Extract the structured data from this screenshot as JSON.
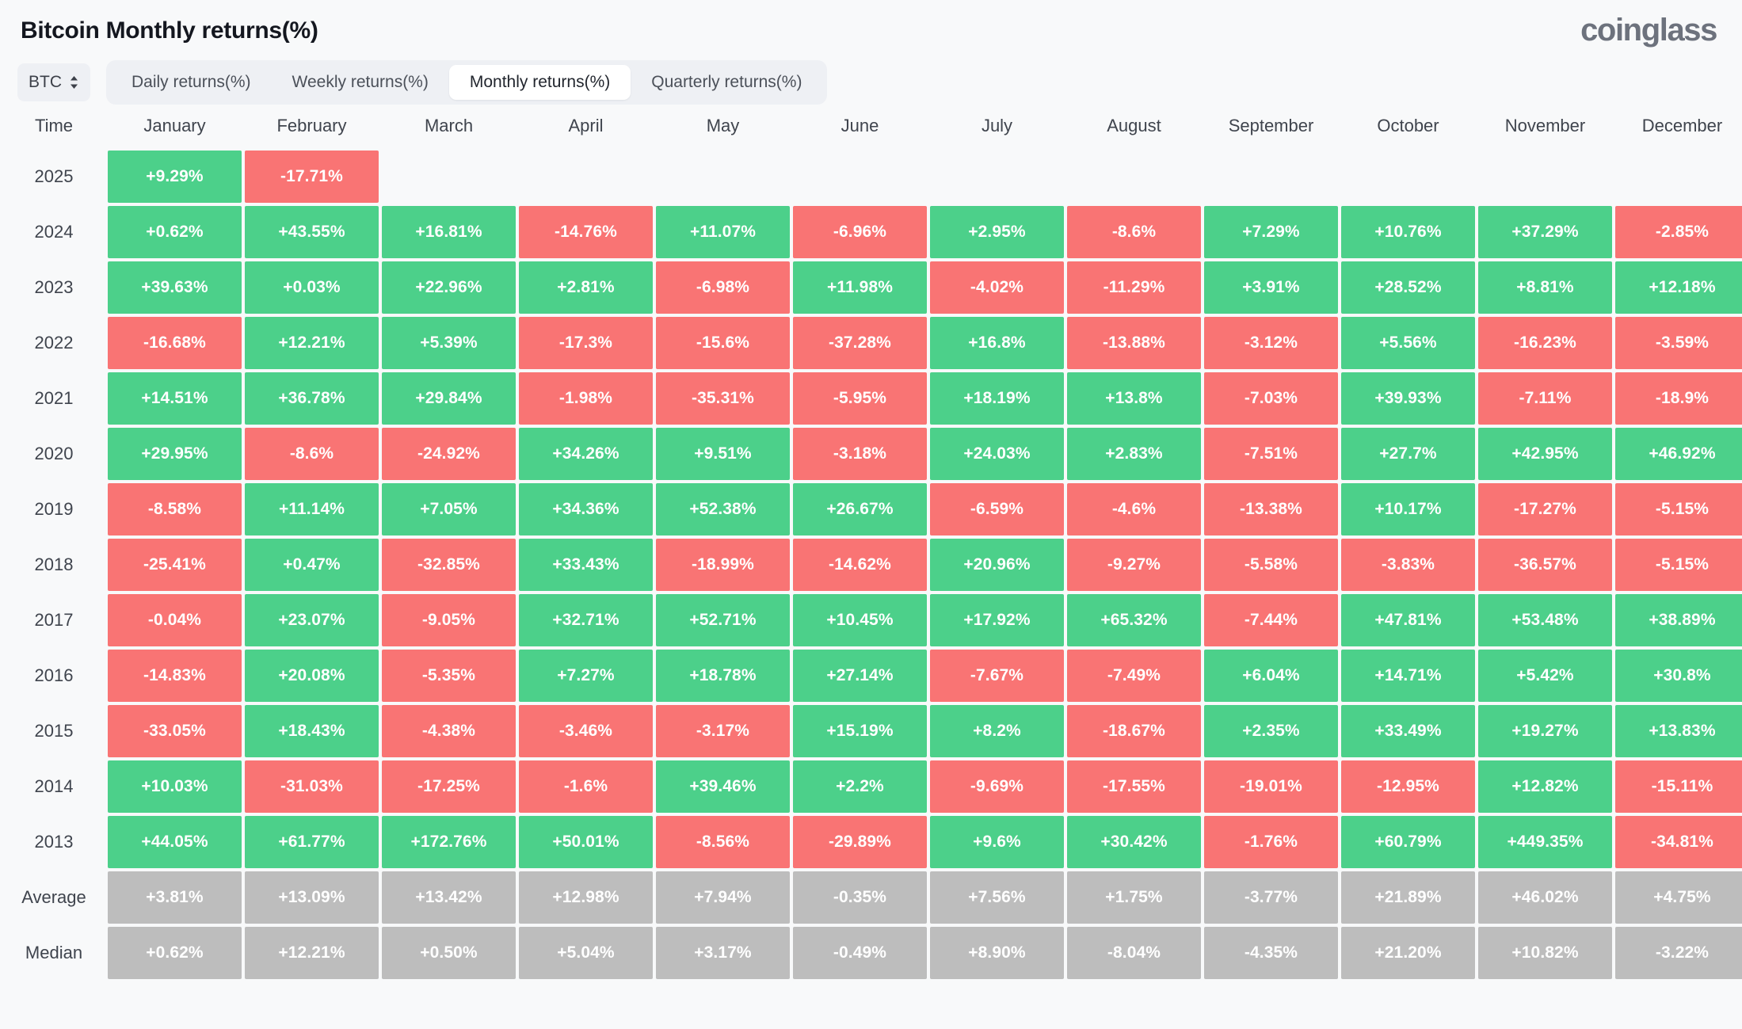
{
  "header": {
    "title": "Bitcoin Monthly returns(%)",
    "brand": "coinglass"
  },
  "controls": {
    "coin_selector": {
      "value": "BTC",
      "icon": "up-down-chevron-icon"
    },
    "tabs": [
      {
        "label": "Daily returns(%)",
        "active": false
      },
      {
        "label": "Weekly returns(%)",
        "active": false
      },
      {
        "label": "Monthly returns(%)",
        "active": true
      },
      {
        "label": "Quarterly returns(%)",
        "active": false
      }
    ]
  },
  "colors": {
    "positive": "#4cd08a",
    "negative": "#f97474",
    "stat": "#bdbdbd",
    "background": "#f8f9fa",
    "tabbar": "#eef0f4"
  },
  "chart_data": {
    "type": "heatmap",
    "title": "Bitcoin Monthly returns(%)",
    "xlabel": "",
    "ylabel": "Time",
    "categories": [
      "January",
      "February",
      "March",
      "April",
      "May",
      "June",
      "July",
      "August",
      "September",
      "October",
      "November",
      "December"
    ],
    "row_header": "Time",
    "rows": [
      {
        "label": "2025",
        "kind": "year",
        "values": [
          "+9.29%",
          "-17.71%",
          "",
          "",
          "",
          "",
          "",
          "",
          "",
          "",
          "",
          ""
        ]
      },
      {
        "label": "2024",
        "kind": "year",
        "values": [
          "+0.62%",
          "+43.55%",
          "+16.81%",
          "-14.76%",
          "+11.07%",
          "-6.96%",
          "+2.95%",
          "-8.6%",
          "+7.29%",
          "+10.76%",
          "+37.29%",
          "-2.85%"
        ]
      },
      {
        "label": "2023",
        "kind": "year",
        "values": [
          "+39.63%",
          "+0.03%",
          "+22.96%",
          "+2.81%",
          "-6.98%",
          "+11.98%",
          "-4.02%",
          "-11.29%",
          "+3.91%",
          "+28.52%",
          "+8.81%",
          "+12.18%"
        ]
      },
      {
        "label": "2022",
        "kind": "year",
        "values": [
          "-16.68%",
          "+12.21%",
          "+5.39%",
          "-17.3%",
          "-15.6%",
          "-37.28%",
          "+16.8%",
          "-13.88%",
          "-3.12%",
          "+5.56%",
          "-16.23%",
          "-3.59%"
        ]
      },
      {
        "label": "2021",
        "kind": "year",
        "values": [
          "+14.51%",
          "+36.78%",
          "+29.84%",
          "-1.98%",
          "-35.31%",
          "-5.95%",
          "+18.19%",
          "+13.8%",
          "-7.03%",
          "+39.93%",
          "-7.11%",
          "-18.9%"
        ]
      },
      {
        "label": "2020",
        "kind": "year",
        "values": [
          "+29.95%",
          "-8.6%",
          "-24.92%",
          "+34.26%",
          "+9.51%",
          "-3.18%",
          "+24.03%",
          "+2.83%",
          "-7.51%",
          "+27.7%",
          "+42.95%",
          "+46.92%"
        ]
      },
      {
        "label": "2019",
        "kind": "year",
        "values": [
          "-8.58%",
          "+11.14%",
          "+7.05%",
          "+34.36%",
          "+52.38%",
          "+26.67%",
          "-6.59%",
          "-4.6%",
          "-13.38%",
          "+10.17%",
          "-17.27%",
          "-5.15%"
        ]
      },
      {
        "label": "2018",
        "kind": "year",
        "values": [
          "-25.41%",
          "+0.47%",
          "-32.85%",
          "+33.43%",
          "-18.99%",
          "-14.62%",
          "+20.96%",
          "-9.27%",
          "-5.58%",
          "-3.83%",
          "-36.57%",
          "-5.15%"
        ]
      },
      {
        "label": "2017",
        "kind": "year",
        "values": [
          "-0.04%",
          "+23.07%",
          "-9.05%",
          "+32.71%",
          "+52.71%",
          "+10.45%",
          "+17.92%",
          "+65.32%",
          "-7.44%",
          "+47.81%",
          "+53.48%",
          "+38.89%"
        ]
      },
      {
        "label": "2016",
        "kind": "year",
        "values": [
          "-14.83%",
          "+20.08%",
          "-5.35%",
          "+7.27%",
          "+18.78%",
          "+27.14%",
          "-7.67%",
          "-7.49%",
          "+6.04%",
          "+14.71%",
          "+5.42%",
          "+30.8%"
        ]
      },
      {
        "label": "2015",
        "kind": "year",
        "values": [
          "-33.05%",
          "+18.43%",
          "-4.38%",
          "-3.46%",
          "-3.17%",
          "+15.19%",
          "+8.2%",
          "-18.67%",
          "+2.35%",
          "+33.49%",
          "+19.27%",
          "+13.83%"
        ]
      },
      {
        "label": "2014",
        "kind": "year",
        "values": [
          "+10.03%",
          "-31.03%",
          "-17.25%",
          "-1.6%",
          "+39.46%",
          "+2.2%",
          "-9.69%",
          "-17.55%",
          "-19.01%",
          "-12.95%",
          "+12.82%",
          "-15.11%"
        ]
      },
      {
        "label": "2013",
        "kind": "year",
        "values": [
          "+44.05%",
          "+61.77%",
          "+172.76%",
          "+50.01%",
          "-8.56%",
          "-29.89%",
          "+9.6%",
          "+30.42%",
          "-1.76%",
          "+60.79%",
          "+449.35%",
          "-34.81%"
        ]
      },
      {
        "label": "Average",
        "kind": "stat",
        "values": [
          "+3.81%",
          "+13.09%",
          "+13.42%",
          "+12.98%",
          "+7.94%",
          "-0.35%",
          "+7.56%",
          "+1.75%",
          "-3.77%",
          "+21.89%",
          "+46.02%",
          "+4.75%"
        ]
      },
      {
        "label": "Median",
        "kind": "stat",
        "values": [
          "+0.62%",
          "+12.21%",
          "+0.50%",
          "+5.04%",
          "+3.17%",
          "-0.49%",
          "+8.90%",
          "-8.04%",
          "-4.35%",
          "+21.20%",
          "+10.82%",
          "-3.22%"
        ]
      }
    ]
  }
}
